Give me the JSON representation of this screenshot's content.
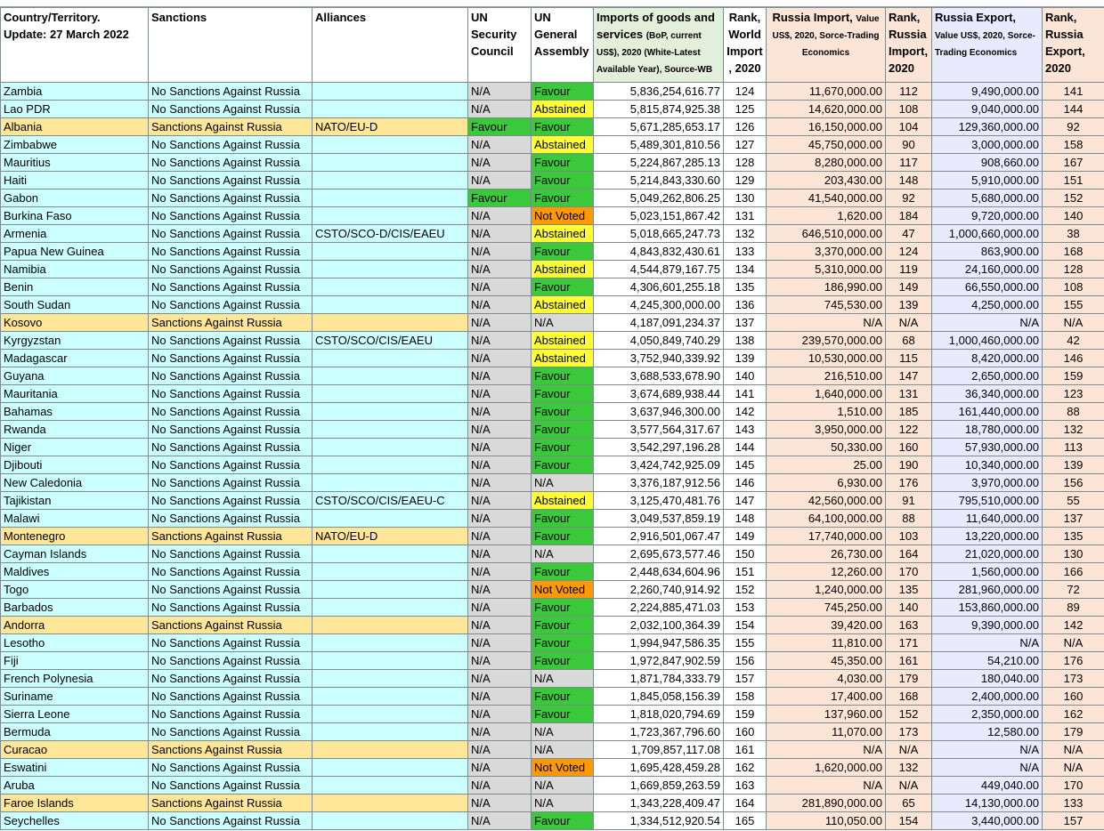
{
  "headers": {
    "country": "Country/Territory. Update: 27 March 2022",
    "sanctions": "Sanctions",
    "alliances": "Alliances",
    "unsc": "UN Security Council",
    "unga": "UN General Assembly",
    "imports_main": "Imports of goods and services",
    "imports_sub": "(BoP, current US$), 2020 (White-Latest Available Year), Source-WB",
    "rank_world": "Rank, World Import , 2020",
    "russia_import_main": "Russia Import,",
    "russia_import_sub": "Value US$, 2020, Sorce-Trading Economics",
    "rank_russia_import": "Rank, Russia Import, 2020",
    "russia_export_main": "Russia Export,",
    "russia_export_sub": "Value US$, 2020, Sorce-Trading Economics",
    "rank_russia_export": "Rank, Russia Export, 2020"
  },
  "rows": [
    {
      "c": "Zambia",
      "s": "No Sanctions Against Russia",
      "a": "",
      "sc": "N/A",
      "ga": "Favour",
      "imp": "5,836,254,616.77",
      "r1": "124",
      "ri": "11,670,000.00",
      "r2": "112",
      "re": "9,490,000.00",
      "r3": "141"
    },
    {
      "c": "Lao PDR",
      "s": "No Sanctions Against Russia",
      "a": "",
      "sc": "N/A",
      "ga": "Abstained",
      "imp": "5,815,874,925.38",
      "r1": "125",
      "ri": "14,620,000.00",
      "r2": "108",
      "re": "9,040,000.00",
      "r3": "144"
    },
    {
      "c": "Albania",
      "s": "Sanctions Against Russia",
      "a": "NATO/EU-D",
      "sc": "Favour",
      "ga": "Favour",
      "imp": "5,671,285,653.17",
      "r1": "126",
      "ri": "16,150,000.00",
      "r2": "104",
      "re": "129,360,000.00",
      "r3": "92"
    },
    {
      "c": "Zimbabwe",
      "s": "No Sanctions Against Russia",
      "a": "",
      "sc": "N/A",
      "ga": "Abstained",
      "imp": "5,489,301,810.56",
      "r1": "127",
      "ri": "45,750,000.00",
      "r2": "90",
      "re": "3,000,000.00",
      "r3": "158"
    },
    {
      "c": "Mauritius",
      "s": "No Sanctions Against Russia",
      "a": "",
      "sc": "N/A",
      "ga": "Favour",
      "imp": "5,224,867,285.13",
      "r1": "128",
      "ri": "8,280,000.00",
      "r2": "117",
      "re": "908,660.00",
      "r3": "167"
    },
    {
      "c": "Haiti",
      "s": "No Sanctions Against Russia",
      "a": "",
      "sc": "N/A",
      "ga": "Favour",
      "imp": "5,214,843,330.60",
      "r1": "129",
      "ri": "203,430.00",
      "r2": "148",
      "re": "5,910,000.00",
      "r3": "151"
    },
    {
      "c": "Gabon",
      "s": "No Sanctions Against Russia",
      "a": "",
      "sc": "Favour",
      "ga": "Favour",
      "imp": "5,049,262,806.25",
      "r1": "130",
      "ri": "41,540,000.00",
      "r2": "92",
      "re": "5,680,000.00",
      "r3": "152"
    },
    {
      "c": "Burkina Faso",
      "s": "No Sanctions Against Russia",
      "a": "",
      "sc": "N/A",
      "ga": "Not Voted",
      "imp": "5,023,151,867.42",
      "r1": "131",
      "ri": "1,620.00",
      "r2": "184",
      "re": "9,720,000.00",
      "r3": "140"
    },
    {
      "c": "Armenia",
      "s": "No Sanctions Against Russia",
      "a": "CSTO/SCO-D/CIS/EAEU",
      "sc": "N/A",
      "ga": "Abstained",
      "imp": "5,018,665,247.73",
      "r1": "132",
      "ri": "646,510,000.00",
      "r2": "47",
      "re": "1,000,660,000.00",
      "r3": "38"
    },
    {
      "c": "Papua New Guinea",
      "s": "No Sanctions Against Russia",
      "a": "",
      "sc": "N/A",
      "ga": "Favour",
      "imp": "4,843,832,430.61",
      "r1": "133",
      "ri": "3,370,000.00",
      "r2": "124",
      "re": "863,900.00",
      "r3": "168"
    },
    {
      "c": "Namibia",
      "s": "No Sanctions Against Russia",
      "a": "",
      "sc": "N/A",
      "ga": "Abstained",
      "imp": "4,544,879,167.75",
      "r1": "134",
      "ri": "5,310,000.00",
      "r2": "119",
      "re": "24,160,000.00",
      "r3": "128"
    },
    {
      "c": "Benin",
      "s": "No Sanctions Against Russia",
      "a": "",
      "sc": "N/A",
      "ga": "Favour",
      "imp": "4,306,601,255.18",
      "r1": "135",
      "ri": "186,990.00",
      "r2": "149",
      "re": "66,550,000.00",
      "r3": "108"
    },
    {
      "c": "South Sudan",
      "s": "No Sanctions Against Russia",
      "a": "",
      "sc": "N/A",
      "ga": "Abstained",
      "imp": "4,245,300,000.00",
      "r1": "136",
      "ri": "745,530.00",
      "r2": "139",
      "re": "4,250,000.00",
      "r3": "155"
    },
    {
      "c": "Kosovo",
      "s": "Sanctions Against Russia",
      "a": "",
      "sc": "N/A",
      "ga": "N/A",
      "imp": "4,187,091,234.37",
      "r1": "137",
      "ri": "N/A",
      "r2": "N/A",
      "re": "N/A",
      "r3": "N/A"
    },
    {
      "c": "Kyrgyzstan",
      "s": "No Sanctions Against Russia",
      "a": "CSTO/SCO/CIS/EAEU",
      "sc": "N/A",
      "ga": "Abstained",
      "imp": "4,050,849,740.29",
      "r1": "138",
      "ri": "239,570,000.00",
      "r2": "68",
      "re": "1,000,460,000.00",
      "r3": "42"
    },
    {
      "c": "Madagascar",
      "s": "No Sanctions Against Russia",
      "a": "",
      "sc": "N/A",
      "ga": "Abstained",
      "imp": "3,752,940,339.92",
      "r1": "139",
      "ri": "10,530,000.00",
      "r2": "115",
      "re": "8,420,000.00",
      "r3": "146"
    },
    {
      "c": "Guyana",
      "s": "No Sanctions Against Russia",
      "a": "",
      "sc": "N/A",
      "ga": "Favour",
      "imp": "3,688,533,678.90",
      "r1": "140",
      "ri": "216,510.00",
      "r2": "147",
      "re": "2,650,000.00",
      "r3": "159"
    },
    {
      "c": "Mauritania",
      "s": "No Sanctions Against Russia",
      "a": "",
      "sc": "N/A",
      "ga": "Favour",
      "imp": "3,674,689,938.44",
      "r1": "141",
      "ri": "1,640,000.00",
      "r2": "131",
      "re": "36,340,000.00",
      "r3": "123"
    },
    {
      "c": "Bahamas",
      "s": "No Sanctions Against Russia",
      "a": "",
      "sc": "N/A",
      "ga": "Favour",
      "imp": "3,637,946,300.00",
      "r1": "142",
      "ri": "1,510.00",
      "r2": "185",
      "re": "161,440,000.00",
      "r3": "88"
    },
    {
      "c": "Rwanda",
      "s": "No Sanctions Against Russia",
      "a": "",
      "sc": "N/A",
      "ga": "Favour",
      "imp": "3,577,564,317.67",
      "r1": "143",
      "ri": "3,950,000.00",
      "r2": "122",
      "re": "18,780,000.00",
      "r3": "132"
    },
    {
      "c": "Niger",
      "s": "No Sanctions Against Russia",
      "a": "",
      "sc": "N/A",
      "ga": "Favour",
      "imp": "3,542,297,196.28",
      "r1": "144",
      "ri": "50,330.00",
      "r2": "160",
      "re": "57,930,000.00",
      "r3": "113"
    },
    {
      "c": "Djibouti",
      "s": "No Sanctions Against Russia",
      "a": "",
      "sc": "N/A",
      "ga": "Favour",
      "imp": "3,424,742,925.09",
      "r1": "145",
      "ri": "25.00",
      "r2": "190",
      "re": "10,340,000.00",
      "r3": "139"
    },
    {
      "c": "New Caledonia",
      "s": "No Sanctions Against Russia",
      "a": "",
      "sc": "N/A",
      "ga": "N/A",
      "imp": "3,376,187,912.56",
      "r1": "146",
      "ri": "6,930.00",
      "r2": "176",
      "re": "3,970,000.00",
      "r3": "156"
    },
    {
      "c": "Tajikistan",
      "s": "No Sanctions Against Russia",
      "a": "CSTO/SCO/CIS/EAEU-C",
      "sc": "N/A",
      "ga": "Abstained",
      "imp": "3,125,470,481.76",
      "r1": "147",
      "ri": "42,560,000.00",
      "r2": "91",
      "re": "795,510,000.00",
      "r3": "55"
    },
    {
      "c": "Malawi",
      "s": "No Sanctions Against Russia",
      "a": "",
      "sc": "N/A",
      "ga": "Favour",
      "imp": "3,049,537,859.19",
      "r1": "148",
      "ri": "64,100,000.00",
      "r2": "88",
      "re": "11,640,000.00",
      "r3": "137"
    },
    {
      "c": "Montenegro",
      "s": "Sanctions Against Russia",
      "a": "NATO/EU-D",
      "sc": "N/A",
      "ga": "Favour",
      "imp": "2,916,501,067.47",
      "r1": "149",
      "ri": "17,740,000.00",
      "r2": "103",
      "re": "13,220,000.00",
      "r3": "135"
    },
    {
      "c": "Cayman Islands",
      "s": "No Sanctions Against Russia",
      "a": "",
      "sc": "N/A",
      "ga": "N/A",
      "imp": "2,695,673,577.46",
      "r1": "150",
      "ri": "26,730.00",
      "r2": "164",
      "re": "21,020,000.00",
      "r3": "130"
    },
    {
      "c": "Maldives",
      "s": "No Sanctions Against Russia",
      "a": "",
      "sc": "N/A",
      "ga": "Favour",
      "imp": "2,448,634,604.96",
      "r1": "151",
      "ri": "12,260.00",
      "r2": "170",
      "re": "1,560,000.00",
      "r3": "166"
    },
    {
      "c": "Togo",
      "s": "No Sanctions Against Russia",
      "a": "",
      "sc": "N/A",
      "ga": "Not Voted",
      "imp": "2,260,740,914.92",
      "r1": "152",
      "ri": "1,240,000.00",
      "r2": "135",
      "re": "281,960,000.00",
      "r3": "72"
    },
    {
      "c": "Barbados",
      "s": "No Sanctions Against Russia",
      "a": "",
      "sc": "N/A",
      "ga": "Favour",
      "imp": "2,224,885,471.03",
      "r1": "153",
      "ri": "745,250.00",
      "r2": "140",
      "re": "153,860,000.00",
      "r3": "89"
    },
    {
      "c": "Andorra",
      "s": "Sanctions Against Russia",
      "a": "",
      "sc": "N/A",
      "ga": "Favour",
      "imp": "2,032,100,364.39",
      "r1": "154",
      "ri": "39,420.00",
      "r2": "163",
      "re": "9,390,000.00",
      "r3": "142"
    },
    {
      "c": "Lesotho",
      "s": "No Sanctions Against Russia",
      "a": "",
      "sc": "N/A",
      "ga": "Favour",
      "imp": "1,994,947,586.35",
      "r1": "155",
      "ri": "11,810.00",
      "r2": "171",
      "re": "N/A",
      "r3": "N/A"
    },
    {
      "c": "Fiji",
      "s": "No Sanctions Against Russia",
      "a": "",
      "sc": "N/A",
      "ga": "Favour",
      "imp": "1,972,847,902.59",
      "r1": "156",
      "ri": "45,350.00",
      "r2": "161",
      "re": "54,210.00",
      "r3": "176"
    },
    {
      "c": "French Polynesia",
      "s": "No Sanctions Against Russia",
      "a": "",
      "sc": "N/A",
      "ga": "N/A",
      "imp": "1,871,784,333.79",
      "r1": "157",
      "ri": "4,030.00",
      "r2": "179",
      "re": "180,040.00",
      "r3": "173"
    },
    {
      "c": "Suriname",
      "s": "No Sanctions Against Russia",
      "a": "",
      "sc": "N/A",
      "ga": "Favour",
      "imp": "1,845,058,156.39",
      "r1": "158",
      "ri": "17,400.00",
      "r2": "168",
      "re": "2,400,000.00",
      "r3": "160"
    },
    {
      "c": "Sierra Leone",
      "s": "No Sanctions Against Russia",
      "a": "",
      "sc": "N/A",
      "ga": "Favour",
      "imp": "1,818,020,794.69",
      "r1": "159",
      "ri": "137,960.00",
      "r2": "152",
      "re": "2,350,000.00",
      "r3": "162"
    },
    {
      "c": "Bermuda",
      "s": "No Sanctions Against Russia",
      "a": "",
      "sc": "N/A",
      "ga": "N/A",
      "imp": "1,723,367,796.60",
      "r1": "160",
      "ri": "11,070.00",
      "r2": "173",
      "re": "12,580.00",
      "r3": "179"
    },
    {
      "c": "Curacao",
      "s": "Sanctions Against Russia",
      "a": "",
      "sc": "N/A",
      "ga": "N/A",
      "imp": "1,709,857,117.08",
      "r1": "161",
      "ri": "N/A",
      "r2": "N/A",
      "re": "N/A",
      "r3": "N/A"
    },
    {
      "c": "Eswatini",
      "s": "No Sanctions Against Russia",
      "a": "",
      "sc": "N/A",
      "ga": "Not Voted",
      "imp": "1,695,428,459.28",
      "r1": "162",
      "ri": "1,620,000.00",
      "r2": "132",
      "re": "N/A",
      "r3": "N/A"
    },
    {
      "c": "Aruba",
      "s": "No Sanctions Against Russia",
      "a": "",
      "sc": "N/A",
      "ga": "N/A",
      "imp": "1,669,859,263.59",
      "r1": "163",
      "ri": "N/A",
      "r2": "N/A",
      "re": "449,040.00",
      "r3": "170"
    },
    {
      "c": "Faroe Islands",
      "s": "Sanctions Against Russia",
      "a": "",
      "sc": "N/A",
      "ga": "N/A",
      "imp": "1,343,228,409.47",
      "r1": "164",
      "ri": "281,890,000.00",
      "r2": "65",
      "re": "14,130,000.00",
      "r3": "133"
    },
    {
      "c": "Seychelles",
      "s": "No Sanctions Against Russia",
      "a": "",
      "sc": "N/A",
      "ga": "Favour",
      "imp": "1,334,512,920.54",
      "r1": "165",
      "ri": "110,050.00",
      "r2": "154",
      "re": "3,440,000.00",
      "r3": "157"
    }
  ],
  "colors": {
    "no_sanctions": "#ccffff",
    "sanctions": "#ffe699",
    "na_gray": "#d9d9d9",
    "favour": "#3ac93a",
    "abstained": "#ffff33",
    "not_voted": "#ff9900",
    "russia_import": "#fce4d6",
    "russia_export": "#eaeaff"
  }
}
